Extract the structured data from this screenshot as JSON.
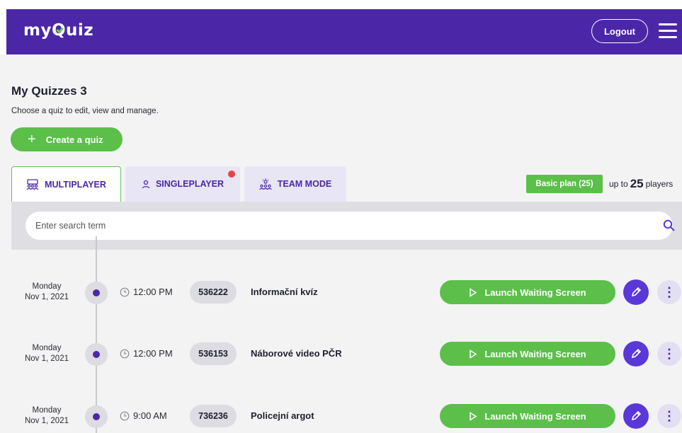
{
  "header": {
    "logo_text_pre": "my",
    "logo_text_q": "Q",
    "logo_text_post": "uiz",
    "logout_label": "Logout"
  },
  "page": {
    "title": "My Quizzes 3",
    "subtitle": "Choose a quiz to edit, view and manage.",
    "create_label": "Create a quiz"
  },
  "tabs": [
    {
      "label": "MULTIPLAYER",
      "active": true
    },
    {
      "label": "SINGLEPLAYER",
      "active": false,
      "notification": true
    },
    {
      "label": "TEAM MODE",
      "active": false
    }
  ],
  "plan": {
    "badge": "Basic plan (25)",
    "limit_pre": "up to",
    "limit_num": "25",
    "limit_post": "players"
  },
  "search": {
    "placeholder": "Enter search term"
  },
  "quizzes": [
    {
      "day": "Monday",
      "date": "Nov 1, 2021",
      "time": "12:00 PM",
      "code": "536222",
      "name": "Informační kvíz",
      "launch_label": "Launch Waiting Screen"
    },
    {
      "day": "Monday",
      "date": "Nov 1, 2021",
      "time": "12:00 PM",
      "code": "536153",
      "name": "Náborové video PČR",
      "launch_label": "Launch Waiting Screen"
    },
    {
      "day": "Monday",
      "date": "Nov 1, 2021",
      "time": "9:00 AM",
      "code": "736236",
      "name": "Policejní argot",
      "launch_label": "Launch Waiting Screen"
    }
  ],
  "colors": {
    "brand": "#4b27a8",
    "accent_green": "#5bbf4a",
    "notification_red": "#e64444"
  },
  "icons": {
    "menu": "hamburger-icon",
    "search": "search-icon",
    "clock": "clock-icon",
    "play": "play-icon",
    "edit": "pencil-icon",
    "more": "more-vertical-icon"
  }
}
